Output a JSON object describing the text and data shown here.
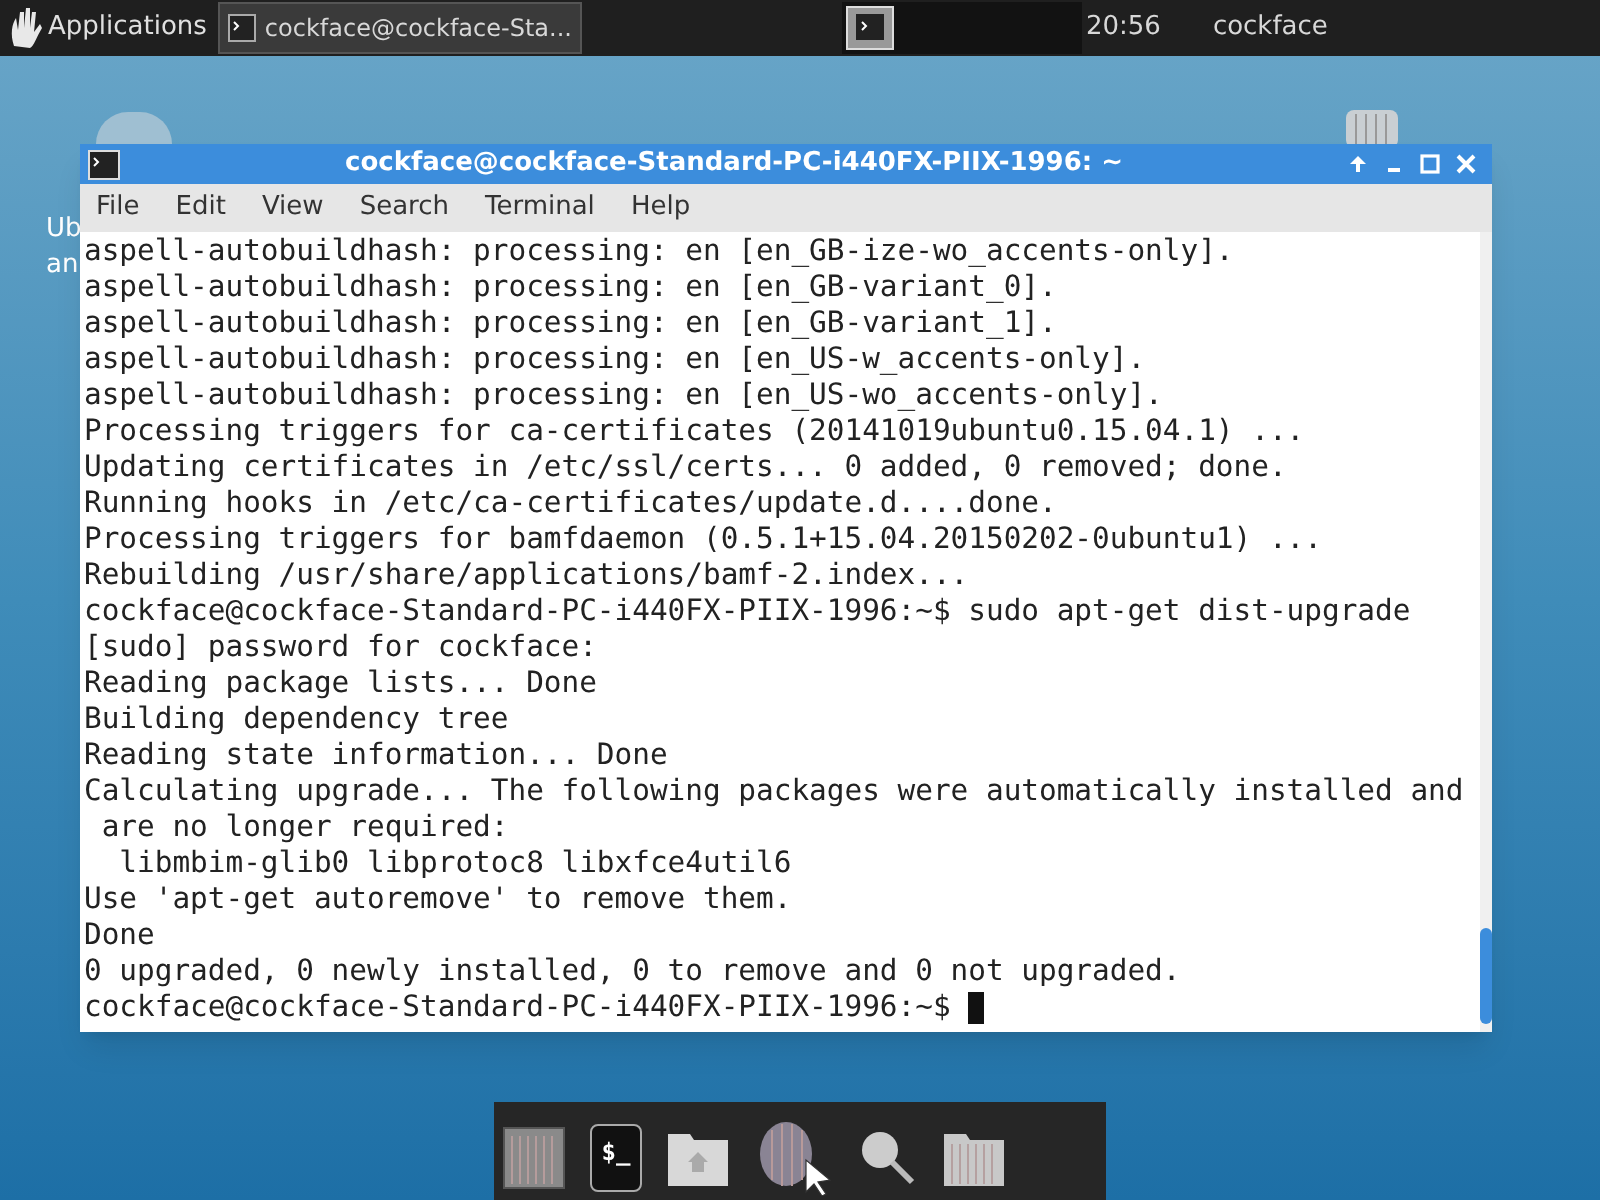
{
  "top_panel": {
    "menu_label": "Applications",
    "task": {
      "title": "cockface@cockface-Sta...",
      "selected": true
    },
    "clock": "20:56",
    "user": "cockface"
  },
  "desktop": {
    "icon_label_lines": [
      "Ub",
      "an"
    ]
  },
  "window": {
    "title": "cockface@cockface-Standard-PC-i440FX-PIIX-1996: ~",
    "menu": [
      "File",
      "Edit",
      "View",
      "Search",
      "Terminal",
      "Help"
    ],
    "lines": [
      "aspell-autobuildhash: processing: en [en_GB-ize-wo_accents-only].",
      "aspell-autobuildhash: processing: en [en_GB-variant_0].",
      "aspell-autobuildhash: processing: en [en_GB-variant_1].",
      "aspell-autobuildhash: processing: en [en_US-w_accents-only].",
      "aspell-autobuildhash: processing: en [en_US-wo_accents-only].",
      "Processing triggers for ca-certificates (20141019ubuntu0.15.04.1) ...",
      "Updating certificates in /etc/ssl/certs... 0 added, 0 removed; done.",
      "Running hooks in /etc/ca-certificates/update.d....done.",
      "Processing triggers for bamfdaemon (0.5.1+15.04.20150202-0ubuntu1) ...",
      "Rebuilding /usr/share/applications/bamf-2.index...",
      "cockface@cockface-Standard-PC-i440FX-PIIX-1996:~$ sudo apt-get dist-upgrade",
      "[sudo] password for cockface:",
      "Reading package lists... Done",
      "Building dependency tree",
      "Reading state information... Done",
      "Calculating upgrade... The following packages were automatically installed and",
      " are no longer required:",
      "  libmbim-glib0 libprotoc8 libxfce4util6",
      "Use 'apt-get autoremove' to remove them.",
      "Done",
      "0 upgraded, 0 newly installed, 0 to remove and 0 not upgraded.",
      "cockface@cockface-Standard-PC-i440FX-PIIX-1996:~$ "
    ]
  },
  "dock": {
    "terminal_label": "$_"
  }
}
